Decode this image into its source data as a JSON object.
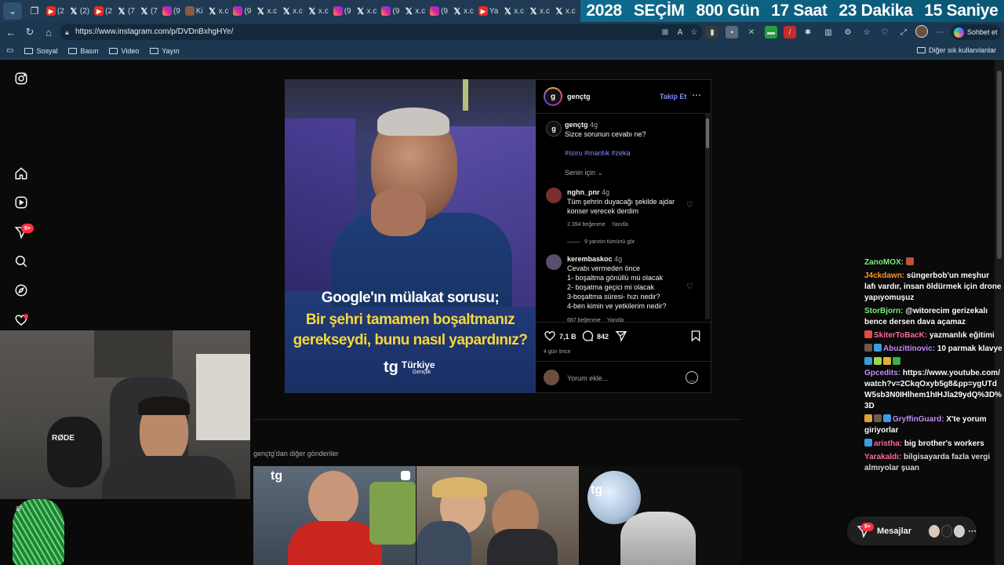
{
  "browser": {
    "tabs": [
      {
        "icon": "youtube",
        "label": "(2"
      },
      {
        "icon": "x",
        "label": "(2)"
      },
      {
        "icon": "youtube",
        "label": "(2"
      },
      {
        "icon": "x",
        "label": "(7"
      },
      {
        "icon": "x",
        "label": "(7"
      },
      {
        "icon": "instagram",
        "label": "(9"
      },
      {
        "icon": "generic",
        "label": "Ki"
      },
      {
        "icon": "x",
        "label": "x.c"
      },
      {
        "icon": "instagram",
        "label": "(9"
      },
      {
        "icon": "x",
        "label": "x.c"
      },
      {
        "icon": "x",
        "label": "x.c"
      },
      {
        "icon": "x",
        "label": "x.c"
      },
      {
        "icon": "instagram",
        "label": "(9"
      },
      {
        "icon": "x",
        "label": "x.c"
      },
      {
        "icon": "instagram",
        "label": "(9"
      },
      {
        "icon": "x",
        "label": "x.c"
      },
      {
        "icon": "instagram",
        "label": "(9"
      },
      {
        "icon": "x",
        "label": "x.c"
      },
      {
        "icon": "youtube",
        "label": "Ya"
      },
      {
        "icon": "x",
        "label": "x.c"
      },
      {
        "icon": "x",
        "label": "x.c"
      },
      {
        "icon": "x",
        "label": "x.c"
      }
    ],
    "url": "https://www.instagram.com/p/DVDnBxhgHYe/",
    "copilot_label": "Sohbet et",
    "bookmarks": [
      "Sosyal",
      "Basın",
      "Video",
      "Yayın"
    ],
    "bookmarks_other": "Diğer sık kullanılanlar"
  },
  "countdown": {
    "year": "2028",
    "event": "SEÇİM",
    "days": "800 Gün",
    "hours": "17 Saat",
    "minutes": "23 Dakika",
    "seconds": "15 Saniye"
  },
  "sidebar": {
    "notifications_badge": "9+"
  },
  "post": {
    "image_text": {
      "line1": "Google'ın mülakat sorusu;",
      "line2": "Bir şehri tamamen boşaltmanız",
      "line3": "gerekseydi, bunu nasıl yapardınız?",
      "brand_title": "Türkiye",
      "brand_sub": "Gençlik",
      "brand_mark": "tg"
    },
    "author": "gençtg",
    "follow_label": "Takip Et",
    "more_icon": "more-horizontal",
    "caption": {
      "username": "gençtg",
      "time": "4g",
      "text": "Sizce sorunun cevabı ne?",
      "tags": "#soru #mantık #zeka"
    },
    "sort_label": "Senin için",
    "comments": [
      {
        "username": "nghn_pnr",
        "time": "4g",
        "text_lines": [
          "Tüm şehrin duyacağı şekilde ajdar",
          "konser verecek derdim"
        ],
        "likes": "2.394 beğenme",
        "reply": "Yanıtla",
        "view_replies": "9 yanıtın tümünü gör"
      },
      {
        "username": "kerembaskoc",
        "time": "4g",
        "text_lines": [
          "Cevabı vermeden önce",
          "1- boşaltma gönüllü mü olacak",
          "2- boşatma geçici mi olacak",
          "3-boşaltma süresi- hızı nedir?",
          "4-ben kimin ve yetkilerim nedir?"
        ],
        "likes": "687 beğenme",
        "reply": "Yanıtla"
      }
    ],
    "like_count": "7,1 B",
    "comment_count": "842",
    "date": "4 gün önce",
    "add_comment_placeholder": "Yorum ekle..."
  },
  "more_posts": {
    "title": "gençtg'dan diğer gönderiler"
  },
  "chat": [
    {
      "user": "ZanoMOX:",
      "color": "#7ef07e",
      "text": ""
    },
    {
      "user": "J4ckdawn:",
      "color": "#ff9c2a",
      "text": "süngerbob'un meşhur lafı vardır, insan öldürmek için drone yapıyomuşuz"
    },
    {
      "user": "StorBjorn:",
      "color": "#7ef07e",
      "text": "@witorecim gerizekalı bence dersen dava açamaz"
    },
    {
      "user": "SkiterToBacK:",
      "color": "#ff6b9d",
      "text": "yazmanlık eğitimi"
    },
    {
      "user": "Abuzittinovic:",
      "color": "#c98cff",
      "text": "10 parmak klavye"
    },
    {
      "user": "Gpcedits:",
      "color": "#c98cff",
      "text": "https://www.youtube.com/watch?v=2CkqOxyb5g8&pp=ygUTdW5sb3N0IHlhem1hIHJla29ydQ%3D%3D"
    },
    {
      "user": "GryffinGuard:",
      "color": "#c98cff",
      "text": "X'te yorum giriyorlar"
    },
    {
      "user": "aristha:",
      "color": "#ff6b9d",
      "text": "big brother's workers"
    },
    {
      "user": "Yarakaldı:",
      "color": "#ff6b9d",
      "text": "bilgisayarda fazla vergi almıyolar şuan"
    }
  ],
  "messages": {
    "label": "Mesajlar",
    "badge": "9+"
  }
}
